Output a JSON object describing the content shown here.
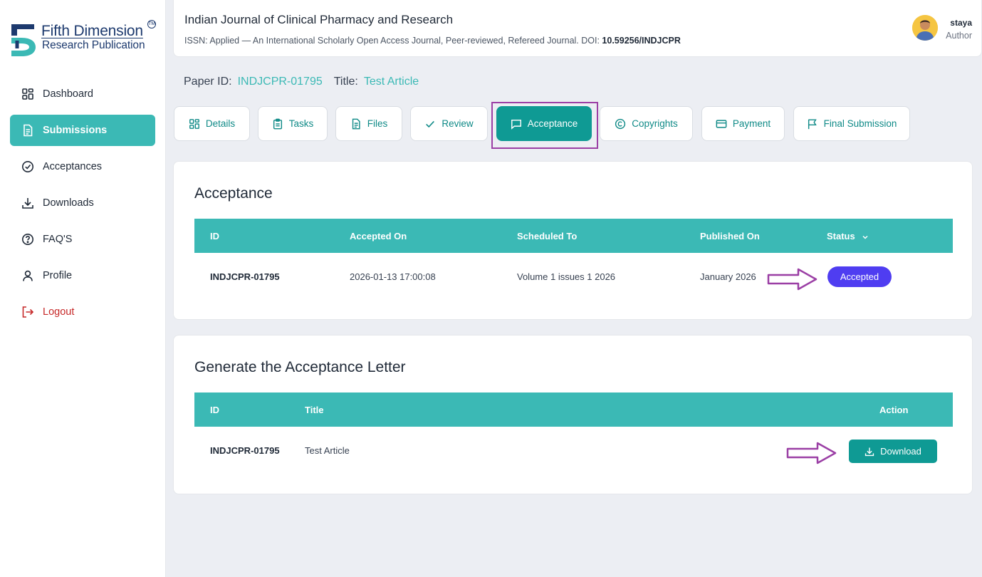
{
  "brand": {
    "line1": "Fifth Dimension",
    "line2": "Research Publication",
    "tm": "TM",
    "colors": {
      "navy": "#1d3a6e",
      "teal": "#3bb9b5"
    }
  },
  "sidebar": {
    "items": [
      {
        "label": "Dashboard",
        "icon": "grid-icon"
      },
      {
        "label": "Submissions",
        "icon": "document-icon",
        "active": true
      },
      {
        "label": "Acceptances",
        "icon": "check-circle-icon"
      },
      {
        "label": "Downloads",
        "icon": "download-icon"
      },
      {
        "label": "FAQ'S",
        "icon": "help-circle-icon"
      },
      {
        "label": "Profile",
        "icon": "user-icon"
      },
      {
        "label": "Logout",
        "icon": "logout-icon"
      }
    ]
  },
  "header": {
    "journal_title": "Indian Journal of Clinical Pharmacy and Research",
    "journal_sub": "ISSN: Applied — An International Scholarly Open Access Journal, Peer-reviewed, Refereed Journal. DOI: ",
    "doi": "10.59256/INDJCPR",
    "user": {
      "name": "staya",
      "role": "Author"
    }
  },
  "paper": {
    "id_label": "Paper ID:",
    "id_value": "INDJCPR-01795",
    "title_label": "Title:",
    "title_value": "Test Article"
  },
  "tabs": [
    {
      "label": "Details",
      "icon": "grid-icon"
    },
    {
      "label": "Tasks",
      "icon": "clipboard-icon"
    },
    {
      "label": "Files",
      "icon": "file-icon"
    },
    {
      "label": "Review",
      "icon": "check-icon"
    },
    {
      "label": "Acceptance",
      "icon": "message-square-icon",
      "active": true
    },
    {
      "label": "Copyrights",
      "icon": "copyright-icon"
    },
    {
      "label": "Payment",
      "icon": "credit-card-icon"
    },
    {
      "label": "Final Submission",
      "icon": "flag-icon"
    }
  ],
  "acceptance": {
    "title": "Acceptance",
    "columns": [
      "ID",
      "Accepted On",
      "Scheduled To",
      "Published On",
      "Status"
    ],
    "row": {
      "id": "INDJCPR-01795",
      "accepted_on": "2026-01-13 17:00:08",
      "scheduled_to": "Volume 1 issues 1 2026",
      "published_on": "January 2026",
      "status": "Accepted"
    },
    "status_color": "#4f3df1"
  },
  "letter": {
    "title": "Generate the Acceptance Letter",
    "columns": [
      "ID",
      "Title",
      "Action"
    ],
    "row": {
      "id": "INDJCPR-01795",
      "title": "Test Article",
      "action": "Download"
    }
  },
  "annotation_color": "#9b3fa5"
}
